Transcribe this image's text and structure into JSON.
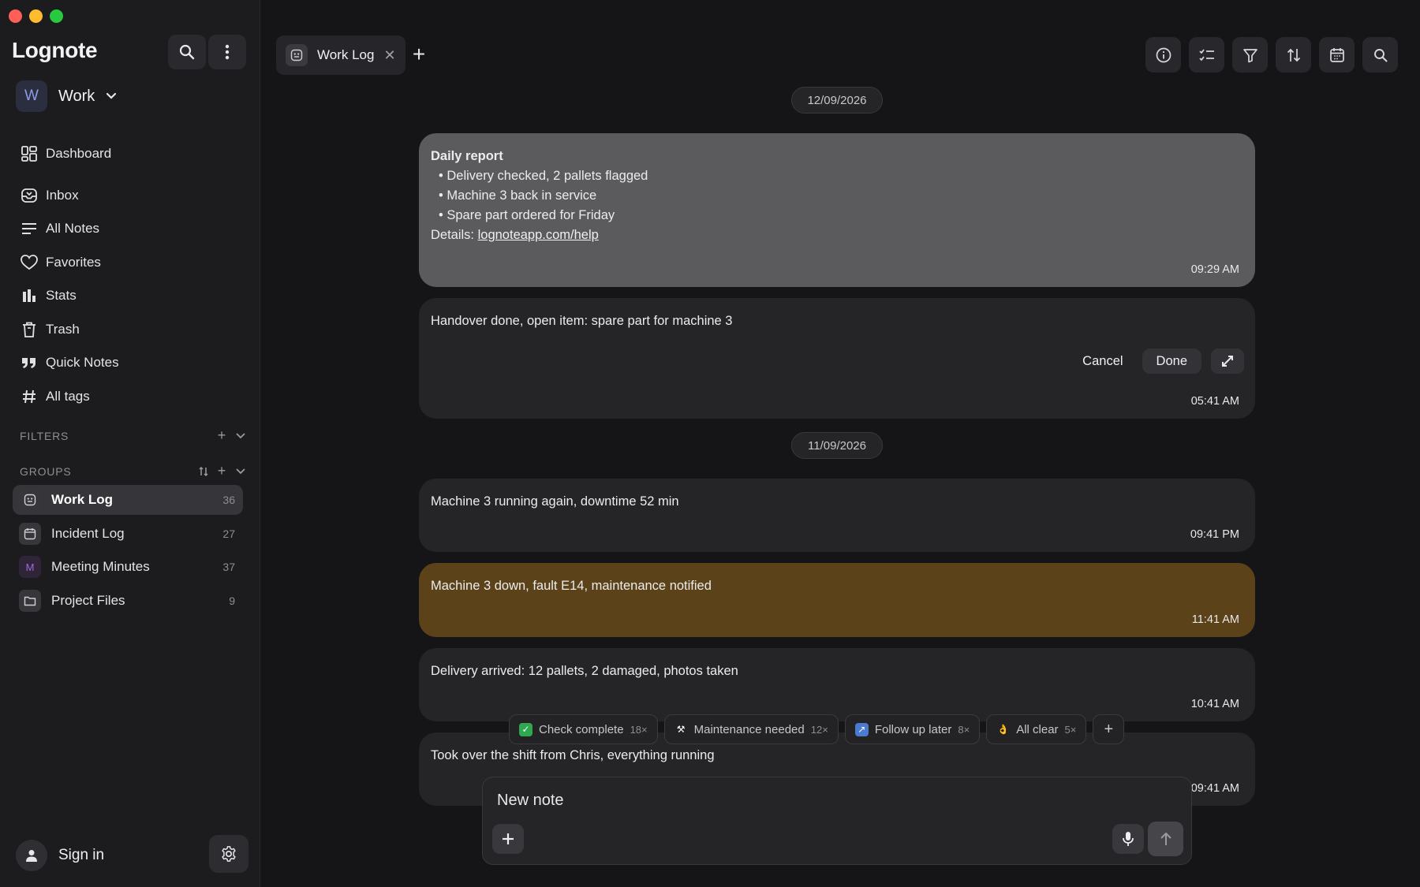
{
  "app": {
    "title": "Lognote"
  },
  "workspace": {
    "initial": "W",
    "name": "Work"
  },
  "nav": [
    {
      "label": "Dashboard",
      "icon": "dashboard-icon"
    },
    {
      "label": "Inbox",
      "icon": "inbox-icon"
    },
    {
      "label": "All Notes",
      "icon": "lines-icon"
    },
    {
      "label": "Favorites",
      "icon": "heart-icon"
    },
    {
      "label": "Stats",
      "icon": "bar-chart-icon"
    },
    {
      "label": "Trash",
      "icon": "trash-icon"
    },
    {
      "label": "Quick Notes",
      "icon": "quote-icon"
    },
    {
      "label": "All tags",
      "icon": "hash-icon"
    }
  ],
  "sections": {
    "filters": "FILTERS",
    "groups": "GROUPS"
  },
  "groups": [
    {
      "label": "Work Log",
      "count": "36",
      "active": true
    },
    {
      "label": "Incident Log",
      "count": "27"
    },
    {
      "label": "Meeting Minutes",
      "count": "37",
      "initial": "M"
    },
    {
      "label": "Project Files",
      "count": "9"
    }
  ],
  "footer": {
    "signin": "Sign in"
  },
  "tab": {
    "label": "Work Log"
  },
  "dates": [
    "12/09/2026",
    "11/09/2026"
  ],
  "notes": {
    "daily": {
      "title": "Daily report",
      "bullets": [
        "Delivery checked, 2 pallets flagged",
        "Machine 3 back in service",
        "Spare part ordered for Friday"
      ],
      "details_label": "Details: ",
      "details_link": "lognoteapp.com/help",
      "time": "09:29 AM"
    },
    "editing": {
      "text": "Handover done, open item: spare part for machine 3",
      "cancel": "Cancel",
      "done": "Done",
      "time": "05:41 AM"
    },
    "n1": {
      "text": "Machine 3 running again, downtime 52 min",
      "time": "09:41 PM"
    },
    "n2": {
      "text": "Machine 3 down, fault E14, maintenance notified",
      "time": "11:41 AM"
    },
    "n3": {
      "text": "Delivery arrived: 12 pallets, 2 damaged, photos taken",
      "time": "10:41 AM"
    },
    "n4": {
      "text": "Took over the shift from Chris, everything running",
      "time": "09:41 AM"
    }
  },
  "quick_tags": [
    {
      "label": "Check complete",
      "count": "18×",
      "emoji": "✓",
      "color": "#2fa84f"
    },
    {
      "label": "Maintenance needed",
      "count": "12×",
      "emoji": "⚒",
      "color": "#3a3a3f"
    },
    {
      "label": "Follow up later",
      "count": "8×",
      "emoji": "↗",
      "color": "#4a7bd0"
    },
    {
      "label": "All clear",
      "count": "5×",
      "emoji": "👌",
      "color": "transparent"
    }
  ],
  "composer": {
    "placeholder": "New note"
  },
  "colors": {
    "accent_amber": "#5b4218",
    "highlight_grey": "#5b5b5e",
    "background": "#151517"
  }
}
